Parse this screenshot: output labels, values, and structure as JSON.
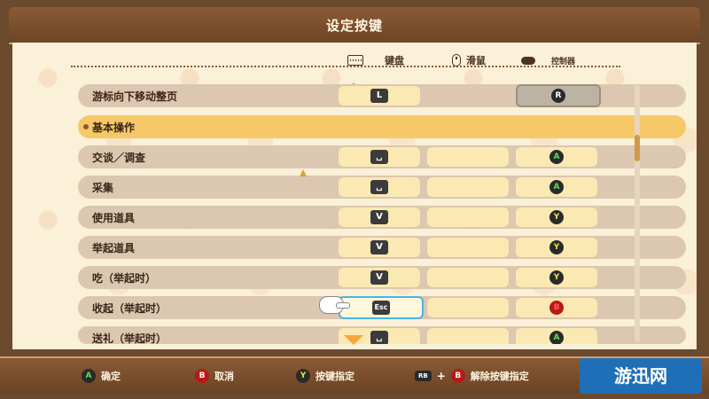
{
  "title": "设定按键",
  "columns": {
    "keyboard": "键盘",
    "mouse": "滑鼠",
    "controller": "控制器"
  },
  "top_row": {
    "label": "游标向下移动整页",
    "keyboard": "L",
    "controller": "R"
  },
  "section": {
    "label": "基本操作"
  },
  "rows": [
    {
      "label": "交谈／调查",
      "keyboard": "␣",
      "controller": "A",
      "ctrl_type": "A"
    },
    {
      "label": "采集",
      "keyboard": "␣",
      "controller": "A",
      "ctrl_type": "A"
    },
    {
      "label": "使用道具",
      "keyboard": "V",
      "controller": "Y",
      "ctrl_type": "Y"
    },
    {
      "label": "举起道具",
      "keyboard": "V",
      "controller": "Y",
      "ctrl_type": "Y"
    },
    {
      "label": "吃（举起时）",
      "keyboard": "V",
      "controller": "Y",
      "ctrl_type": "Y"
    },
    {
      "label": "收起（举起时）",
      "keyboard": "Esc",
      "controller": "B",
      "ctrl_type": "B"
    },
    {
      "label": "送礼（举起时）",
      "keyboard": "␣",
      "controller": "A",
      "ctrl_type": "A"
    }
  ],
  "footer": {
    "confirm": "确定",
    "cancel": "取消",
    "assign": "按键指定",
    "unassign": "解除按键指定",
    "rb_label": "RB",
    "btn_a": "A",
    "btn_b": "B",
    "btn_y": "Y"
  },
  "watermark": "游迅网"
}
